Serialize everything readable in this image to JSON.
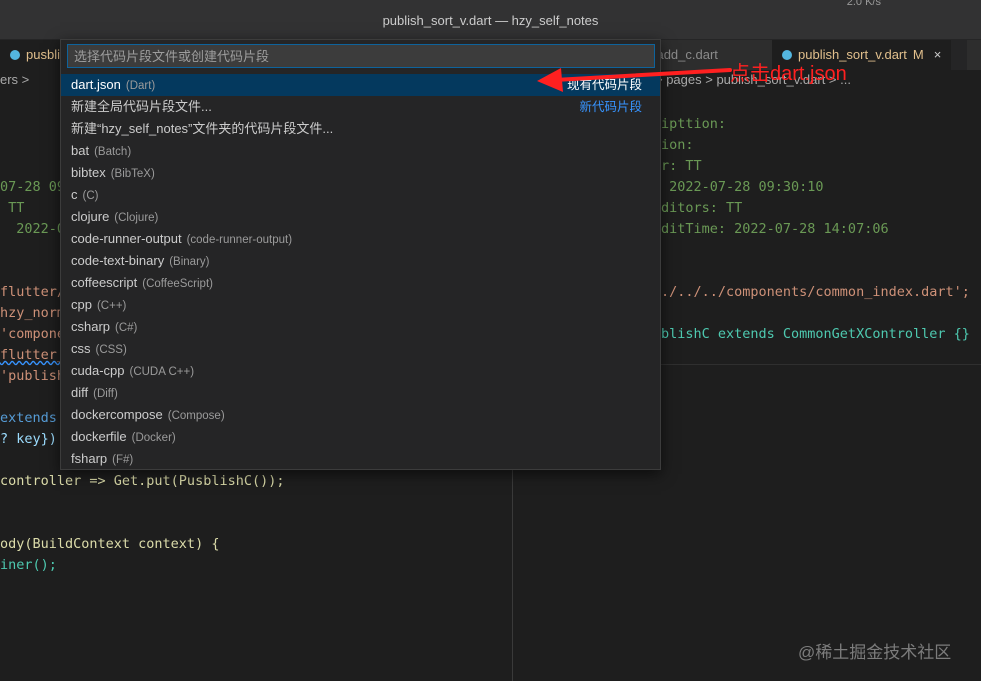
{
  "window": {
    "title": "publish_sort_v.dart — hzy_self_notes",
    "net_speed": "2.0 K/s"
  },
  "tabs": {
    "left_partial": "pusblish",
    "right_partial": "n_add_c.dart",
    "active": "publish_sort_v.dart",
    "active_badge": "M",
    "close": "×"
  },
  "breadcrumbs": {
    "left": "ers >",
    "right": "> pages > publish_sort_v.dart > ..."
  },
  "quick_pick": {
    "placeholder": "选择代码片段文件或创建代码片段",
    "items": [
      {
        "label": "dart.json",
        "desc": "(Dart)",
        "group": "现有代码片段"
      },
      {
        "label": "新建全局代码片段文件...",
        "desc": "",
        "group": "新代码片段"
      },
      {
        "label": "新建“hzy_self_notes”文件夹的代码片段文件...",
        "desc": "",
        "group": ""
      },
      {
        "label": "bat",
        "desc": "(Batch)",
        "group": ""
      },
      {
        "label": "bibtex",
        "desc": "(BibTeX)",
        "group": ""
      },
      {
        "label": "c",
        "desc": "(C)",
        "group": ""
      },
      {
        "label": "clojure",
        "desc": "(Clojure)",
        "group": ""
      },
      {
        "label": "code-runner-output",
        "desc": "(code-runner-output)",
        "group": ""
      },
      {
        "label": "code-text-binary",
        "desc": "(Binary)",
        "group": ""
      },
      {
        "label": "coffeescript",
        "desc": "(CoffeeScript)",
        "group": ""
      },
      {
        "label": "cpp",
        "desc": "(C++)",
        "group": ""
      },
      {
        "label": "csharp",
        "desc": "(C#)",
        "group": ""
      },
      {
        "label": "css",
        "desc": "(CSS)",
        "group": ""
      },
      {
        "label": "cuda-cpp",
        "desc": "(CUDA C++)",
        "group": ""
      },
      {
        "label": "diff",
        "desc": "(Diff)",
        "group": ""
      },
      {
        "label": "dockercompose",
        "desc": "(Compose)",
        "group": ""
      },
      {
        "label": "dockerfile",
        "desc": "(Docker)",
        "group": ""
      },
      {
        "label": "fsharp",
        "desc": "(F#)",
        "group": ""
      }
    ]
  },
  "annotation": "点击dart.json",
  "left_code": [
    "07-28 09:",
    " TT",
    "  2022-0",
    "flutter/",
    "hzy_norm",
    "'compone",
    "flutter_",
    "'publish",
    "extends",
    "? key})",
    "controller => Get.put(PusblishC());",
    "ody(BuildContext context) {",
    "iner();"
  ],
  "right_code": [
    "ipttion:",
    "ion:",
    "r: TT",
    " 2022-07-28 09:30:10",
    "ditors: TT",
    "ditTime: 2022-07-28 14:07:06",
    "./../../components/common_index.dart';",
    "blishC extends CommonGetXController {}"
  ],
  "watermark": "@稀土掘金技术社区",
  "colors": {
    "accent": "#0e639c",
    "selection": "#04395e",
    "annotation": "#ff2020",
    "modified": "#e2c08d"
  }
}
